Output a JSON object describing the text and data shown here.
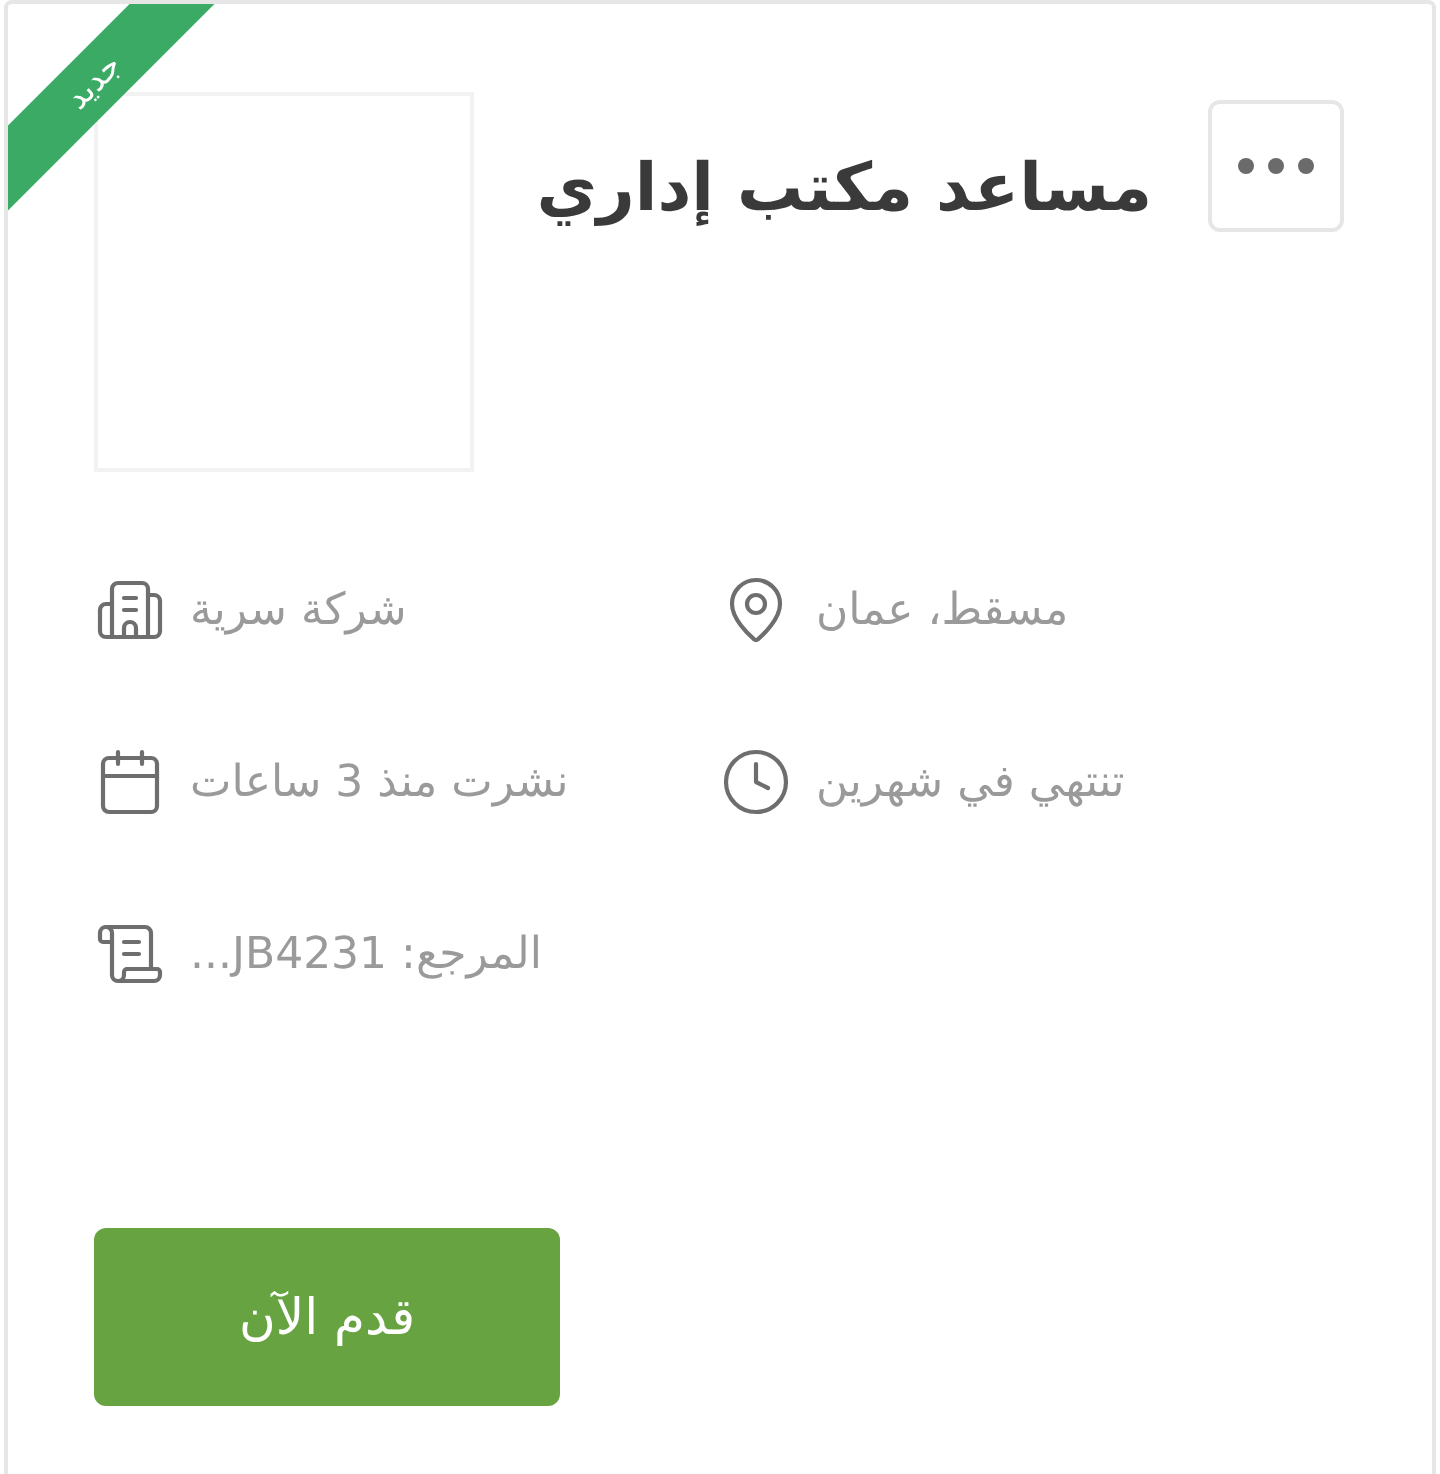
{
  "badge": "جديد",
  "title": "مساعد مكتب إداري",
  "details": [
    {
      "kind": "location",
      "text": "مسقط، عمان"
    },
    {
      "kind": "company",
      "text": "شركة سرية"
    },
    {
      "kind": "expires",
      "text": "تنتهي في شهرين"
    },
    {
      "kind": "posted",
      "text": "نشرت منذ 3 ساعات"
    },
    {
      "kind": "reference",
      "text": "المرجع: JB4231..."
    }
  ],
  "apply_button": "قدم الآن"
}
